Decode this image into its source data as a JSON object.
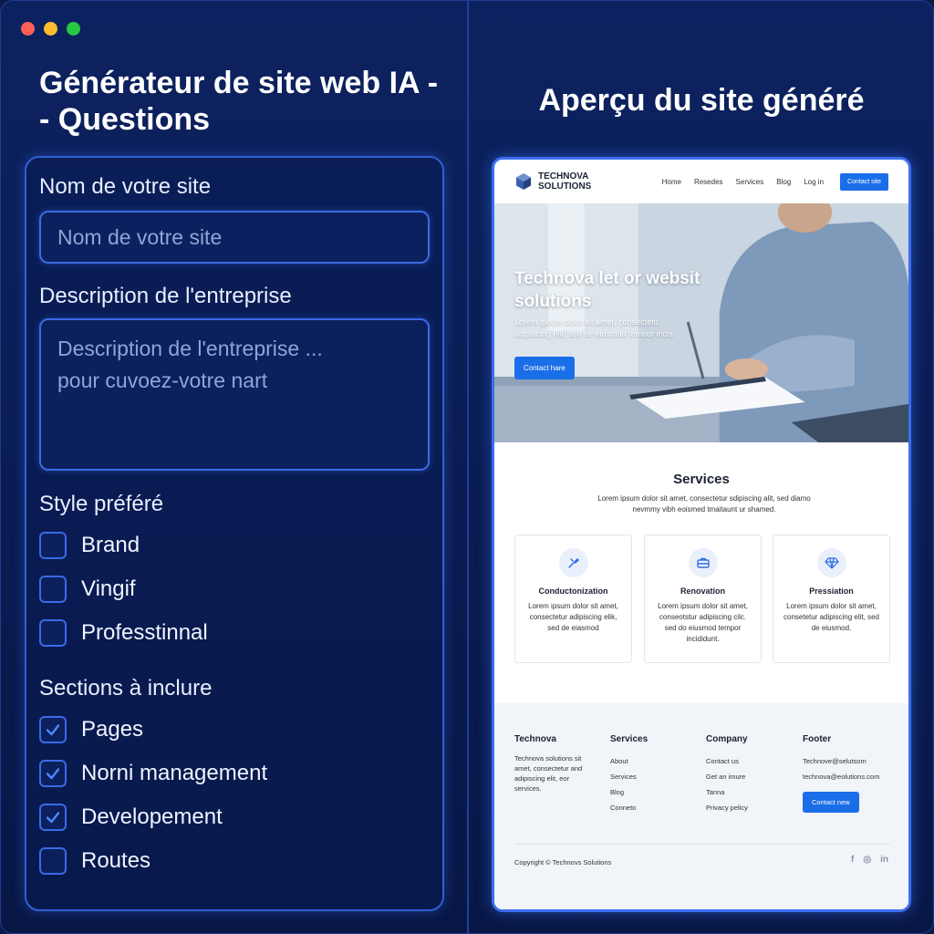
{
  "left": {
    "title": "Générateur de site web IA - - Questions",
    "site_name_label": "Nom de votre site",
    "site_name_placeholder": "Nom de votre site",
    "description_label": "Description de l'entreprise",
    "description_placeholder_line1": "Description de l'entreprise ...",
    "description_placeholder_line2": "pour cuvoez-votre nart",
    "style_label": "Style préféré",
    "style_options": [
      {
        "label": "Brand",
        "checked": false
      },
      {
        "label": "Vingif",
        "checked": false
      },
      {
        "label": "Professtinnal",
        "checked": false
      }
    ],
    "sections_label": "Sections à inclure",
    "section_options": [
      {
        "label": "Pages",
        "checked": true
      },
      {
        "label": "Norni management",
        "checked": true
      },
      {
        "label": "Developement",
        "checked": true
      },
      {
        "label": "Routes",
        "checked": false
      }
    ]
  },
  "right": {
    "title": "Aperçu du site généré",
    "site": {
      "logo_line1": "TECHNOVA",
      "logo_line2": "SOLUTIONS",
      "nav": [
        "Home",
        "Resedes",
        "Services",
        "Blog",
        "Log in"
      ],
      "nav_cta": "Contact site",
      "hero_title": "Technova let or websit solutions",
      "hero_text": "Lorem ipeum doior sit amet, consectetu adipiscing elit, sed oe eiusmad temoor incis",
      "hero_button": "Contact hare",
      "services_title": "Services",
      "services_sub": "Lorem ipsum dolor sit amet, consectetur sdipiscing alit, sed diamo nevmmy vibh eoismed tmaitaunt ur shamed.",
      "cards": [
        {
          "icon": "tools-icon",
          "title": "Conductonization",
          "text": "Lorem ipsum dolor sit amet, consectetur adipiscing elik, sed de eiasmod"
        },
        {
          "icon": "briefcase-icon",
          "title": "Renovation",
          "text": "Lorem ipsum dolor sit amet, conseotstur adipiscing cilc. sed do eiusmod tempor incididunt."
        },
        {
          "icon": "diamond-icon",
          "title": "Pressiation",
          "text": "Lorem ipsum dolor sit amet, consetetur adipiscing elit, sed de eiusmod."
        }
      ],
      "footer": {
        "col1_head": "Technova",
        "col1_text": "Technova solutions sit amet, consectetur and adipiscing elit, eor services.",
        "col2_head": "Services",
        "col2_items": [
          "About",
          "Services",
          "Blog",
          "Conneto"
        ],
        "col3_head": "Company",
        "col3_items": [
          "Contact us",
          "Get an imure",
          "Tanna",
          "Privacy pelicy"
        ],
        "col4_head": "Footer",
        "col4_items": [
          "Technove@selutsom",
          "technova@eolutions.com"
        ],
        "col4_button": "Contact new",
        "copyright": "Copyright © Technovs Solutions",
        "socials": [
          "f",
          "◎",
          "in"
        ]
      }
    }
  },
  "colors": {
    "background": "#0a1c52",
    "accent": "#3a6ae6",
    "site_button": "#1a6ee8"
  }
}
